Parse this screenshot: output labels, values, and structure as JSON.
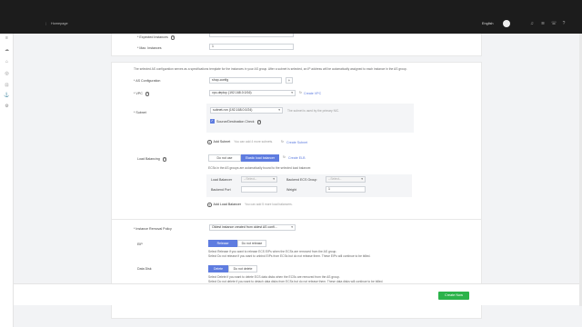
{
  "topbar": {
    "breadcrumb": "Homepage",
    "language": "English"
  },
  "form": {
    "expected_instances_label": "Expected Instances",
    "max_instances_label": "Max. Instances",
    "max_instances_value": "1",
    "note": "The selected AS configuration serves as a specifications template for the instances in your AS group. After a subnet is selected, an IP address will be automatically assigned to each instance in the AS group.",
    "as_config_label": "AS Configuration",
    "as_config_value": "shop-config",
    "vpc_label": "VPC",
    "vpc_value": "vpc-deploy (192.168.0.0/16)",
    "create_vpc": "Create VPC",
    "subnet_label": "Subnet",
    "subnet_value": "subnet-ron (192.168.0.0/24)",
    "subnet_hint": "The subnet is used by the primary NIC.",
    "source_dest_check": "Source/Destination Check",
    "add_subnet": "Add Subnet",
    "add_subnet_hint": "You can add 4 more subnets.",
    "create_subnet": "Create Subnet",
    "lb_label": "Load Balancing",
    "lb_options": [
      "Do not use",
      "Elastic load balancer"
    ],
    "create_elb": "Create ELB",
    "lb_note": "ECSs in the AS groups are automatically bound to the selected load balancer.",
    "load_balancer_label": "Load Balancer",
    "load_balancer_placeholder": "--Select--",
    "backend_group_label": "Backend ECS Group",
    "backend_group_placeholder": "--Select--",
    "backend_port_label": "Backend Port",
    "weight_label": "Weight",
    "weight_value": "1",
    "add_lb": "Add Load Balancer",
    "add_lb_hint": "You can add 5 more load balancers.",
    "removal_policy_label": "Instance Removal Policy",
    "removal_policy_value": "Oldest instance created from oldest AS confi...",
    "eip_label": "EIP",
    "eip_options": [
      "Release",
      "Do not release"
    ],
    "eip_desc_1": "Select Release if you want to release ECS EIPs when the ECSs are removed from the AS group.",
    "eip_desc_2": "Select Do not release if you want to unbind EIPs from ECSs but do not release them. These EIPs will continue to be billed.",
    "disk_label": "Data Disk",
    "disk_options": [
      "Delete",
      "Do not delete"
    ],
    "disk_desc_1": "Select Delete if you want to delete ECS data disks when the ECSs are removed from the AS group.",
    "disk_desc_2": "Select Do not delete if you want to detach data disks from ECSs but do not release them. These data disks will continue to be billed."
  },
  "footer": {
    "create_button": "Create Now"
  }
}
